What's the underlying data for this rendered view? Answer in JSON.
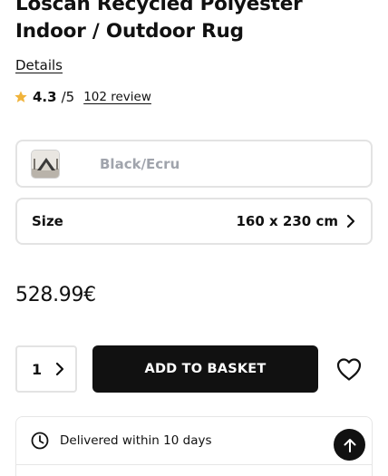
{
  "product": {
    "title": "Loscan Recycled Polyester Indoor / Outdoor Rug",
    "details_link": "Details"
  },
  "rating": {
    "score": "4.3",
    "out_of": "/5",
    "reviews": "102 review",
    "star_color": "#f0b33a"
  },
  "color_selector": {
    "label": "Black/Ecru",
    "swatch_icon": "rug-thumbnail"
  },
  "size_selector": {
    "label": "Size",
    "value": "160 x 230 cm",
    "icon": "chevron-right-icon"
  },
  "price": "528.99€",
  "purchase": {
    "quantity": "1",
    "add_to_basket": "ADD TO BASKET",
    "wishlist_icon": "heart-icon",
    "button_color": "#111111"
  },
  "delivery": {
    "text": "Delivered within 10 days",
    "icon": "clock-icon"
  },
  "scroll_top_icon": "arrow-up-icon"
}
